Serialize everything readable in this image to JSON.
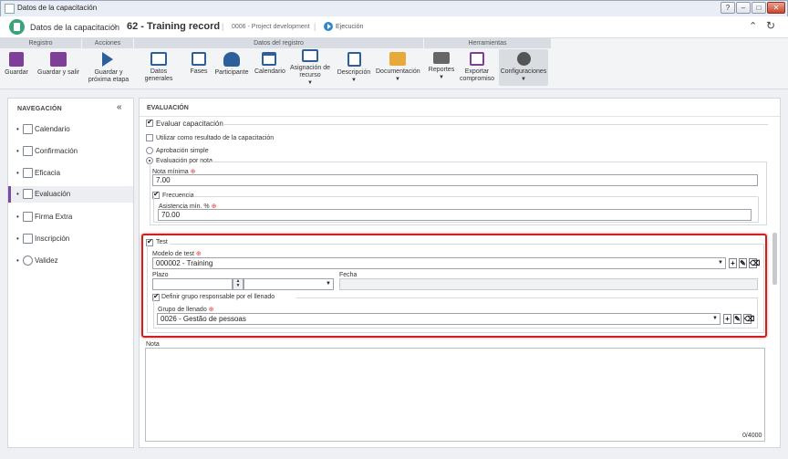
{
  "window": {
    "title": "Datos de la capacitación"
  },
  "header": {
    "module": "Datos de la capacitación",
    "record": "62 - Training record",
    "project": "0006 - Project development",
    "status": "Ejecución"
  },
  "ribbon": {
    "groups": [
      "Registro",
      "Acciones",
      "Datos del registro",
      "Herramientas"
    ],
    "buttons": {
      "guardar": "Guardar",
      "guardar_salir": "Guardar y salir",
      "guardar_proxima_1": "Guardar y",
      "guardar_proxima_2": "próxima etapa",
      "datos_generales": "Datos generales",
      "fases": "Fases",
      "participante": "Participante",
      "calendario": "Calendario",
      "asignacion_1": "Asignación de",
      "asignacion_2": "recurso",
      "descripcion": "Descripción",
      "documentacion": "Documentación",
      "reportes": "Reportes",
      "exportar_1": "Exportar",
      "exportar_2": "compromiso",
      "configuraciones": "Configuraciones"
    }
  },
  "sidebar": {
    "title": "NAVEGACIÓN",
    "items": [
      {
        "label": "Calendario"
      },
      {
        "label": "Confirmación"
      },
      {
        "label": "Eficacia"
      },
      {
        "label": "Evaluación"
      },
      {
        "label": "Firma Extra"
      },
      {
        "label": "Inscripción"
      },
      {
        "label": "Validez"
      }
    ]
  },
  "main": {
    "title": "EVALUACIÓN",
    "evaluar_capacitacion": "Evaluar capacitación",
    "utilizar_resultado": "Utilizar como resultado de la capacitación",
    "aprobacion_simple": "Aprobación simple",
    "evaluacion_por_nota": "Evaluación por nota",
    "nota_minima_label": "Nota mínima",
    "nota_minima_value": "7.00",
    "frecuencia": "Frecuencia",
    "asistencia_label": "Asistencia mín. %",
    "asistencia_value": "70.00",
    "test_label": "Test",
    "modelo_test_label": "Modelo de test",
    "modelo_test_value": "000002 - Training",
    "plazo_label": "Plazo",
    "fecha_label": "Fecha",
    "definir_grupo": "Definir grupo responsable por el llenado",
    "grupo_label": "Grupo de llenado",
    "grupo_value": "0026 - Gestão de pessoas",
    "nota_label": "Nota",
    "nota_counter": "0/4000"
  },
  "colors": {
    "highlight": "#cf2020",
    "active_nav": "#7b4a9e",
    "app_icon": "#3aa37a",
    "status_icon": "#2f86c9"
  }
}
